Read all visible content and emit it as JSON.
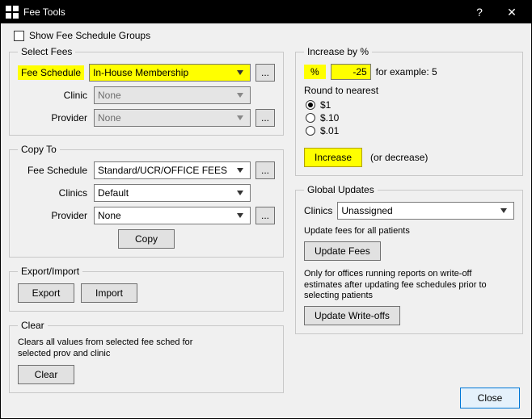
{
  "window": {
    "title": "Fee Tools",
    "help": "?",
    "close_glyph": "✕"
  },
  "show_groups_label": "Show Fee Schedule Groups",
  "select_fees": {
    "legend": "Select Fees",
    "fee_schedule_label": "Fee Schedule",
    "fee_schedule_value": "In-House Membership",
    "clinic_label": "Clinic",
    "clinic_value": "None",
    "provider_label": "Provider",
    "provider_value": "None",
    "ellipsis": "..."
  },
  "copy_to": {
    "legend": "Copy To",
    "fee_schedule_label": "Fee Schedule",
    "fee_schedule_value": "Standard/UCR/OFFICE FEES",
    "clinics_label": "Clinics",
    "clinics_value": "Default",
    "provider_label": "Provider",
    "provider_value": "None",
    "copy_label": "Copy",
    "ellipsis": "..."
  },
  "export_import": {
    "legend": "Export/Import",
    "export_label": "Export",
    "import_label": "Import"
  },
  "clear": {
    "legend": "Clear",
    "desc": "Clears all values from selected fee sched for selected prov and clinic",
    "clear_label": "Clear"
  },
  "increase": {
    "legend": "Increase by %",
    "pct_symbol": "%",
    "pct_value": "-25",
    "example": "for example: 5",
    "round_legend": "Round to nearest",
    "r1": "$1",
    "r10": "$.10",
    "r01": "$.01",
    "increase_label": "Increase",
    "or_decrease": "(or decrease)"
  },
  "global": {
    "legend": "Global Updates",
    "clinics_label": "Clinics",
    "clinics_value": "Unassigned",
    "update_note": "Update fees for all patients",
    "update_fees_label": "Update Fees",
    "writeoff_note": "Only for offices running reports on write-off estimates after updating fee schedules prior to selecting patients",
    "update_writeoffs_label": "Update Write-offs"
  },
  "close_label": "Close"
}
